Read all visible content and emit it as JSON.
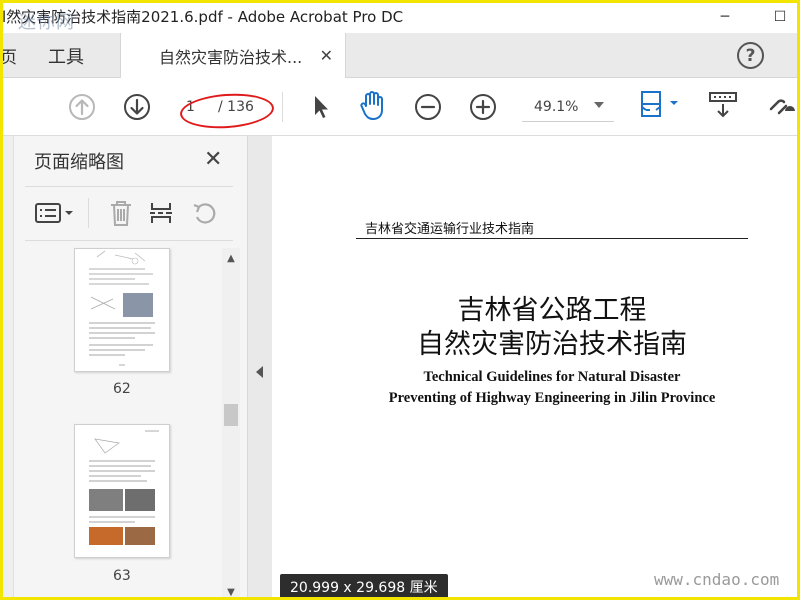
{
  "window": {
    "title": "l然灾害防治技术指南2021.6.pdf - Adobe Acrobat Pro DC",
    "watermark_top_left": "迷你网",
    "minimize": "─",
    "maximize": "☐"
  },
  "tabs": {
    "home": "页",
    "tools": "工具",
    "document": "自然灾害防治技术...",
    "close": "✕",
    "help": "?"
  },
  "toolbar": {
    "page_current": "1",
    "page_total": "/ 136",
    "zoom": "49.1%",
    "colors": {
      "accent": "#1a73c8",
      "annotation": "#e01a1a"
    }
  },
  "thumbnails_panel": {
    "title": "页面缩略图",
    "close": "✕",
    "pages": [
      {
        "label": "62"
      },
      {
        "label": "63"
      }
    ]
  },
  "document": {
    "header": "吉林省交通运输行业技术指南",
    "title_line1": "吉林省公路工程",
    "title_line2": "自然灾害防治技术指南",
    "english_line1": "Technical Guidelines for Natural Disaster",
    "english_line2": "Preventing of Highway Engineering in Jilin Province"
  },
  "status": {
    "page_size": "20.999 x 29.698 厘米"
  },
  "watermark_bottom_right": "www.cndao.com"
}
